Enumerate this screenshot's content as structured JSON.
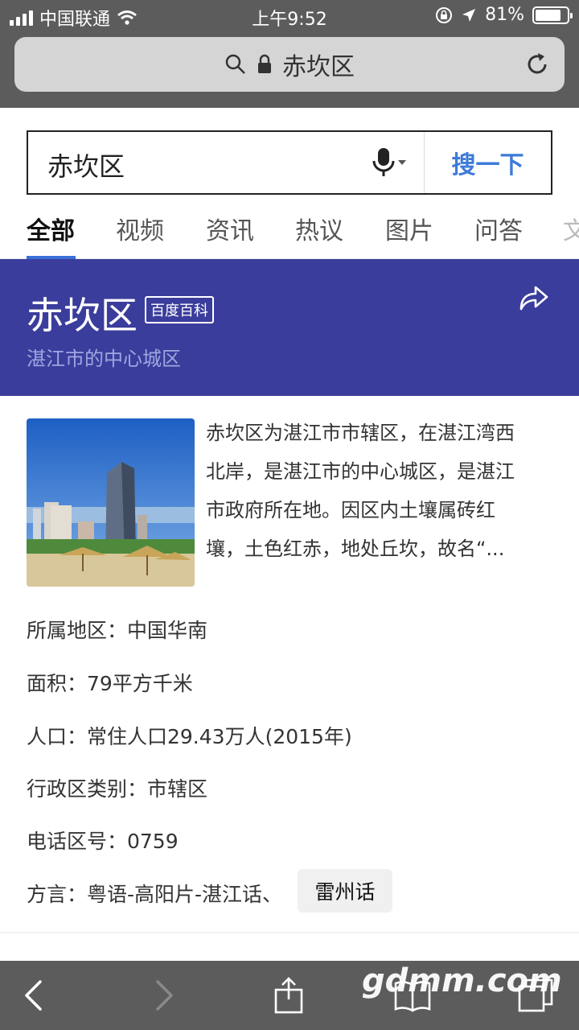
{
  "status_bar": {
    "carrier": "中国联通",
    "time": "上午9:52",
    "battery_percent": "81%",
    "battery_level": 0.81
  },
  "address_bar": {
    "text": "赤坎区"
  },
  "search": {
    "query": "赤坎区",
    "button_label": "搜一下"
  },
  "tabs": [
    {
      "label": "全部",
      "active": true
    },
    {
      "label": "视频"
    },
    {
      "label": "资讯"
    },
    {
      "label": "热议"
    },
    {
      "label": "图片"
    },
    {
      "label": "问答"
    },
    {
      "label": "文"
    }
  ],
  "baike": {
    "title": "赤坎区",
    "badge": "百度百科",
    "subtitle": "湛江市的中心城区",
    "summary_lines": [
      "赤坎区为湛江市市辖区，在湛江湾西",
      "北岸，是湛江市的中心城区，是湛江",
      "市政府所在地。因区内土壤属砖红",
      "壤，土色红赤，地处丘坎，故名“..."
    ],
    "info": [
      "所属地区：中国华南",
      "面积：79平方千米",
      "人口：常住人口29.43万人(2015年)",
      "行政区类别：市辖区",
      "电话区号：0759",
      "方言：粤语-高阳片-湛江话、"
    ],
    "dialect_tag": "雷州话"
  },
  "watermark": "gdmm.com",
  "colors": {
    "header_blue": "#3b3d9c",
    "accent_blue": "#3e7bd8",
    "chrome_gray": "#5c5c5c"
  }
}
